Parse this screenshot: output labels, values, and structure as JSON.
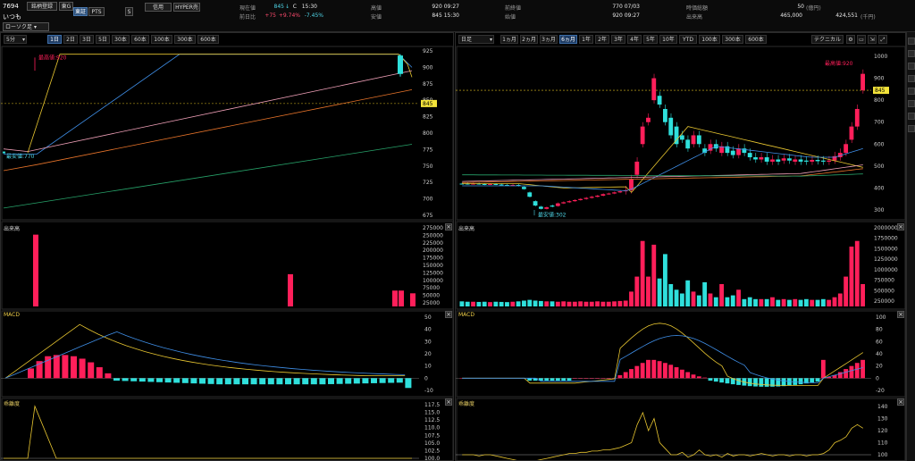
{
  "header": {
    "code": "7694",
    "name": "いつも",
    "register_btn": "銘柄登録",
    "market_btn": "東G",
    "tse_btn": "東証",
    "pts_btn": "PTS",
    "s_btn": "S",
    "credit_btn": "信用",
    "hyper_btn": "HYPER売",
    "current_label": "現在値",
    "current_value": "845",
    "current_arrow": "↓",
    "current_c": "C",
    "current_time": "15:30",
    "change_label": "前日比",
    "change_value": "+75",
    "change_pct": "+9.74%",
    "change_pct2": "-7.45%",
    "high_label": "高値",
    "high_value": "920 09:27",
    "low_label": "安値",
    "low_value": "845 15:30",
    "prev_label": "前終値",
    "prev_value": "770 07/03",
    "open_label": "始値",
    "open_value": "920 09:27",
    "mcap_label": "時価総額",
    "mcap_value": "50",
    "mcap_unit": "(億円)",
    "volume_label": "出来高",
    "volume_value": "465,000",
    "turnover_value": "424,551",
    "turnover_unit": "(千円)"
  },
  "left": {
    "interval_select": "5分",
    "style_select": "ローソク足",
    "tabs": [
      "1日",
      "2日",
      "3日",
      "5日",
      "30本",
      "60本",
      "100本",
      "300本",
      "600本"
    ],
    "selected_tab": 0,
    "price_axis": [
      "925",
      "900",
      "875",
      "850",
      "825",
      "800",
      "775",
      "750",
      "725",
      "700",
      "675"
    ],
    "price_tag": "845",
    "high_annot": "最高値:920",
    "low_annot": "最安値:770",
    "volume_label": "出来高",
    "volume_axis": [
      "275000",
      "250000",
      "225000",
      "200000",
      "175000",
      "150000",
      "125000",
      "100000",
      "75000",
      "50000",
      "25000"
    ],
    "macd_label": "MACD",
    "macd_axis": [
      "50",
      "40",
      "30",
      "20",
      "10",
      "0",
      "-10"
    ],
    "dev_label": "乖離度",
    "dev_axis": [
      "117.5",
      "115.0",
      "112.5",
      "110.0",
      "107.5",
      "105.0",
      "102.5",
      "100.0"
    ]
  },
  "right": {
    "interval_select": "日足",
    "tabs": [
      "1ヵ月",
      "2ヵ月",
      "3ヵ月",
      "6ヵ月",
      "1年",
      "2年",
      "3年",
      "4年",
      "5年",
      "10年",
      "YTD",
      "100本",
      "300本",
      "600本"
    ],
    "selected_tab": 3,
    "technical_btn": "テクニカル",
    "price_axis": [
      "1000",
      "900",
      "800",
      "700",
      "600",
      "500",
      "400",
      "300"
    ],
    "price_tag": "845",
    "high_annot": "最高値:920",
    "low_annot": "最安値:302",
    "volume_label": "出来高",
    "volume_axis": [
      "2000000",
      "1750000",
      "1500000",
      "1250000",
      "1000000",
      "750000",
      "500000",
      "250000"
    ],
    "macd_label": "MACD",
    "macd_axis": [
      "100",
      "80",
      "60",
      "40",
      "20",
      "0",
      "-20"
    ],
    "dev_label": "乖離度",
    "dev_axis": [
      "140",
      "130",
      "120",
      "110",
      "100"
    ]
  },
  "colors": {
    "up": "#ff1f5a",
    "down": "#2fe0dc",
    "ma_short": "#e8c630",
    "ma_mid": "#3f8fe8",
    "ma_pink": "#f0a0b8",
    "ma_orange": "#e8742a",
    "ma_green": "#27a36a"
  }
}
